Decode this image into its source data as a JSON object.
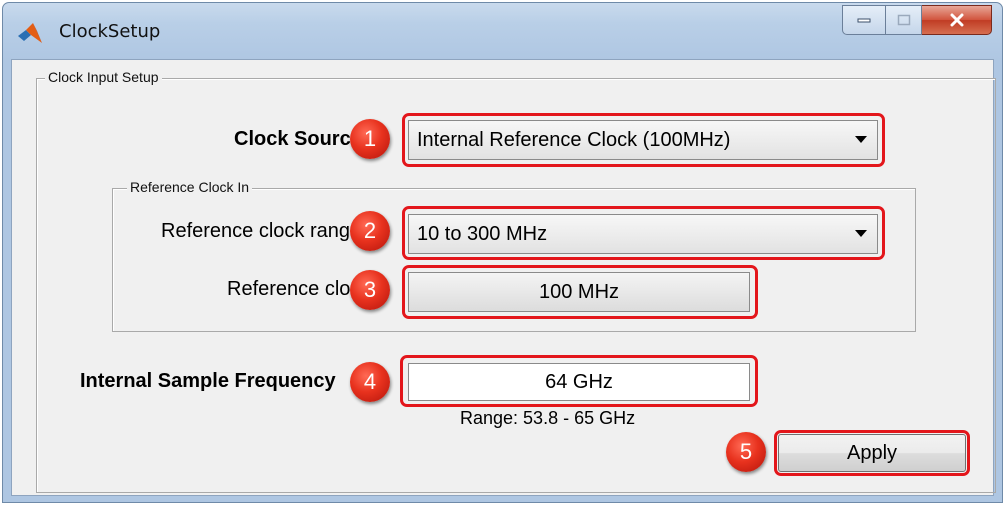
{
  "window": {
    "title": "ClockSetup"
  },
  "clock_input_setup": {
    "legend": "Clock Input Setup",
    "clock_source": {
      "label": "Clock Source",
      "value": "Internal Reference Clock (100MHz)"
    },
    "reference_clock_in": {
      "legend": "Reference Clock In",
      "range_label": "Reference clock range",
      "range_value": "10 to 300 MHz",
      "clock_label": "Reference clock",
      "clock_value": "100 MHz"
    },
    "internal_sample_frequency": {
      "label": "Internal Sample Frequency",
      "value": "64 GHz",
      "range_text": "Range: 53.8 - 65 GHz"
    },
    "apply_label": "Apply"
  },
  "markers": [
    "1",
    "2",
    "3",
    "4",
    "5"
  ],
  "colors": {
    "highlight": "#e3161b",
    "marker": "#e8321e",
    "client_bg": "#f0f0f0"
  },
  "icons": {
    "app": "matlab-logo-icon",
    "minimize": "minimize-icon",
    "maximize": "maximize-icon",
    "close": "close-icon"
  }
}
